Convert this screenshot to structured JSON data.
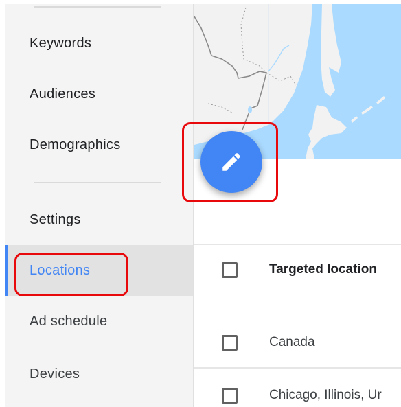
{
  "sidebar": {
    "items": [
      {
        "label": "Keywords",
        "active": false
      },
      {
        "label": "Audiences",
        "active": false
      },
      {
        "label": "Demographics",
        "active": false
      },
      {
        "label": "Settings",
        "active": false
      },
      {
        "label": "Locations",
        "active": true
      },
      {
        "label": "Ad schedule",
        "active": false
      },
      {
        "label": "Devices",
        "active": false
      }
    ]
  },
  "main": {
    "map": {
      "region": "map-view",
      "water_color": "#aadaff",
      "land_color": "#f2f2f2"
    },
    "edit_button": {
      "icon": "pencil-icon",
      "color": "#4285f4"
    },
    "table": {
      "header": "Targeted location",
      "rows": [
        {
          "location": "Canada"
        },
        {
          "location": "Chicago, Illinois, Ur"
        }
      ]
    }
  },
  "annotations": {
    "highlight_color": "#e8090c"
  }
}
